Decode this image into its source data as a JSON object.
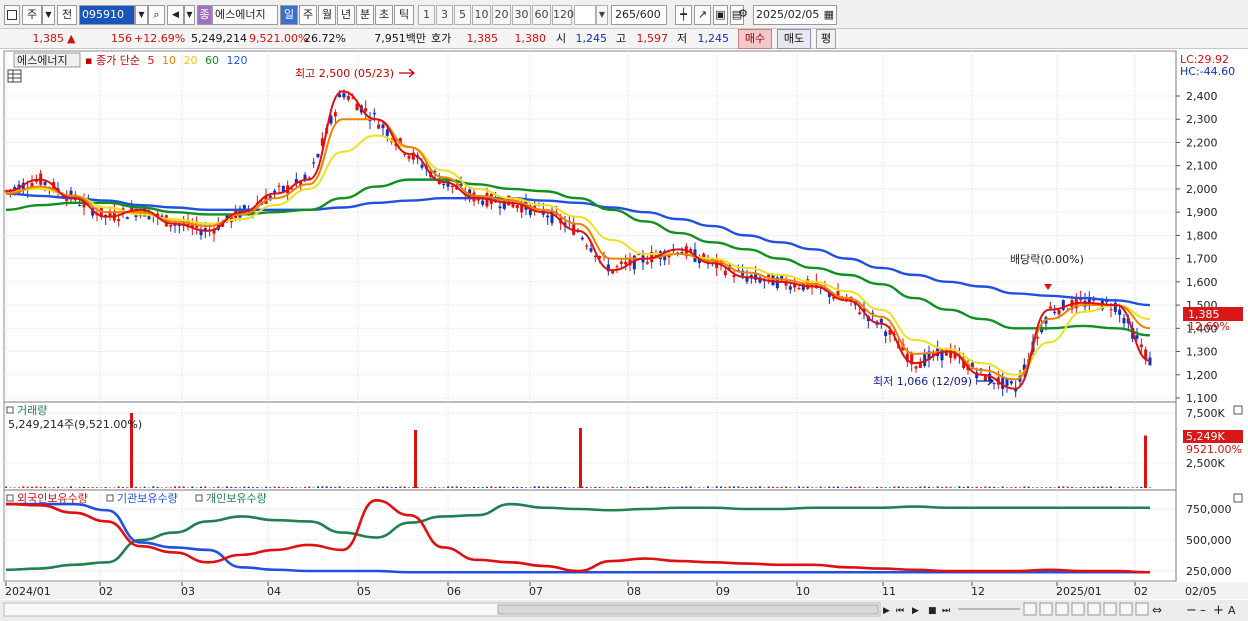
{
  "toolbar": {
    "mode_label": "주",
    "jeon_label": "전",
    "code": "095910",
    "name_badge": "종",
    "name": "에스에너지",
    "periods": [
      "일",
      "주",
      "월",
      "년",
      "분",
      "초",
      "틱"
    ],
    "counts": [
      "1",
      "3",
      "5",
      "10",
      "20",
      "30",
      "60",
      "120"
    ],
    "candle_count": "265",
    "candle_total": "/600",
    "date": "2025/02/05"
  },
  "quote": {
    "price": "1,385",
    "change": "156",
    "change_pct": "+12.69%",
    "volume": "5,249,214",
    "volume_ratio": "9,521.00%",
    "turnover": "26.72%",
    "amount": "7,951백만",
    "hoga_label": "호가",
    "ask": "1,385",
    "bid": "1,380",
    "open_label": "시",
    "open": "1,245",
    "high_label": "고",
    "high": "1,597",
    "low_label": "저",
    "low": "1,245",
    "buy_label": "매수",
    "sell_label": "매도",
    "eval_label": "평"
  },
  "price_panel": {
    "title": "에스에너지",
    "ma_label": "종가 단순",
    "ma_periods": [
      "5",
      "10",
      "20",
      "60",
      "120"
    ],
    "max_label": "최고 2,500 (05/23)",
    "min_label": "최저 1,066 (12/09)",
    "dividend_label": "배당락(0.00%)",
    "lc_label": "LC:29.92",
    "hc_label": "HC:-44.60",
    "current_price_tag": "1,385",
    "current_pct_tag": "12.69%",
    "axis_ticks": [
      "2,400",
      "2,300",
      "2,200",
      "2,100",
      "2,000",
      "1,900",
      "1,800",
      "1,700",
      "1,600",
      "1,500",
      "1,400",
      "1,300",
      "1,200",
      "1,100"
    ]
  },
  "volume_panel": {
    "title": "거래량",
    "value_label": "5,249,214주(9,521.00%)",
    "axis_ticks": [
      "7,500K",
      "2,500K"
    ],
    "current_tag": "5,249K",
    "ratio_tag": "9521.00%"
  },
  "holdings_panel": {
    "legend": [
      "외국인보유수량",
      "기관보유수량",
      "개인보유수량"
    ],
    "axis_ticks": [
      "750,000",
      "500,000",
      "250,000"
    ]
  },
  "x_axis": [
    "2024/01",
    "02",
    "03",
    "04",
    "05",
    "06",
    "07",
    "08",
    "09",
    "10",
    "11",
    "12",
    "2025/01",
    "02",
    "02/05"
  ],
  "colors": {
    "up": "#e01010",
    "down": "#1030c0",
    "ma5": "#e01010",
    "ma10": "#f08000",
    "ma20": "#f0e020",
    "ma60": "#109020",
    "ma120": "#2050e0",
    "foreign": "#e01010",
    "institution": "#2050e0",
    "individual": "#208050"
  },
  "chart_data": {
    "type": "candlestick",
    "series": [
      {
        "name": "5",
        "values": [
          1990,
          2040,
          1960,
          1880,
          1910,
          1850,
          1820,
          1900,
          1980,
          2040,
          2420,
          2300,
          2150,
          2030,
          1960,
          1940,
          1900,
          1820,
          1650,
          1700,
          1740,
          1680,
          1620,
          1600,
          1580,
          1520,
          1420,
          1250,
          1300,
          1200,
          1140,
          1480,
          1510,
          1500,
          1260
        ]
      },
      {
        "name": "10",
        "values": [
          1980,
          2010,
          1970,
          1900,
          1900,
          1860,
          1840,
          1890,
          1960,
          2020,
          2300,
          2300,
          2180,
          2050,
          1970,
          1950,
          1910,
          1850,
          1700,
          1700,
          1720,
          1690,
          1640,
          1610,
          1590,
          1530,
          1450,
          1290,
          1300,
          1220,
          1180,
          1440,
          1500,
          1500,
          1400
        ]
      },
      {
        "name": "20",
        "values": [
          1990,
          2000,
          1970,
          1920,
          1890,
          1870,
          1850,
          1870,
          1930,
          2000,
          2160,
          2230,
          2180,
          2080,
          2000,
          1960,
          1930,
          1880,
          1780,
          1720,
          1720,
          1700,
          1660,
          1630,
          1600,
          1560,
          1480,
          1350,
          1310,
          1250,
          1200,
          1340,
          1470,
          1500,
          1440
        ]
      },
      {
        "name": "60",
        "values": [
          1910,
          1930,
          1940,
          1940,
          1920,
          1900,
          1890,
          1890,
          1900,
          1910,
          1960,
          2010,
          2040,
          2040,
          2020,
          2000,
          1990,
          1960,
          1910,
          1860,
          1810,
          1770,
          1740,
          1700,
          1660,
          1630,
          1590,
          1530,
          1480,
          1440,
          1400,
          1400,
          1410,
          1400,
          1370
        ]
      },
      {
        "name": "120",
        "values": [
          1980,
          1970,
          1960,
          1950,
          1930,
          1920,
          1910,
          1910,
          1910,
          1910,
          1920,
          1940,
          1950,
          1960,
          1960,
          1960,
          1950,
          1940,
          1920,
          1900,
          1870,
          1840,
          1800,
          1770,
          1740,
          1700,
          1660,
          1630,
          1600,
          1580,
          1550,
          1540,
          1530,
          1520,
          1500
        ]
      },
      {
        "name": "외국인보유수량",
        "values": [
          790000,
          780000,
          720000,
          650000,
          450000,
          400000,
          320000,
          380000,
          420000,
          460000,
          420000,
          820000,
          700000,
          440000,
          340000,
          320000,
          290000,
          250000,
          330000,
          350000,
          330000,
          320000,
          310000,
          300000,
          300000,
          280000,
          270000,
          260000,
          250000,
          250000,
          250000,
          260000,
          250000,
          250000,
          240000
        ]
      },
      {
        "name": "기관보유수량",
        "values": [
          790000,
          790000,
          790000,
          740000,
          480000,
          440000,
          420000,
          280000,
          260000,
          250000,
          250000,
          250000,
          240000,
          240000,
          240000,
          240000,
          240000,
          240000,
          240000,
          240000,
          240000,
          240000,
          240000,
          240000,
          240000,
          240000,
          240000,
          240000,
          240000,
          240000,
          240000,
          240000,
          240000,
          240000,
          240000
        ]
      },
      {
        "name": "개인보유수량",
        "values": [
          260000,
          270000,
          300000,
          320000,
          500000,
          560000,
          650000,
          690000,
          660000,
          650000,
          560000,
          520000,
          640000,
          690000,
          700000,
          790000,
          760000,
          750000,
          740000,
          750000,
          760000,
          760000,
          750000,
          750000,
          760000,
          760000,
          760000,
          770000,
          760000,
          760000,
          760000,
          760000,
          760000,
          760000,
          760000
        ]
      }
    ],
    "volume_x": [
      "02",
      "05",
      "06",
      "07",
      "2025/02"
    ],
    "volume_spikes": [
      7500000,
      6000000,
      5800000,
      6000000,
      5249214
    ],
    "ylim": [
      1050,
      2500
    ],
    "volume_ylim": [
      0,
      7500000
    ],
    "holdings_ylim": [
      200000,
      800000
    ],
    "grid": true
  }
}
